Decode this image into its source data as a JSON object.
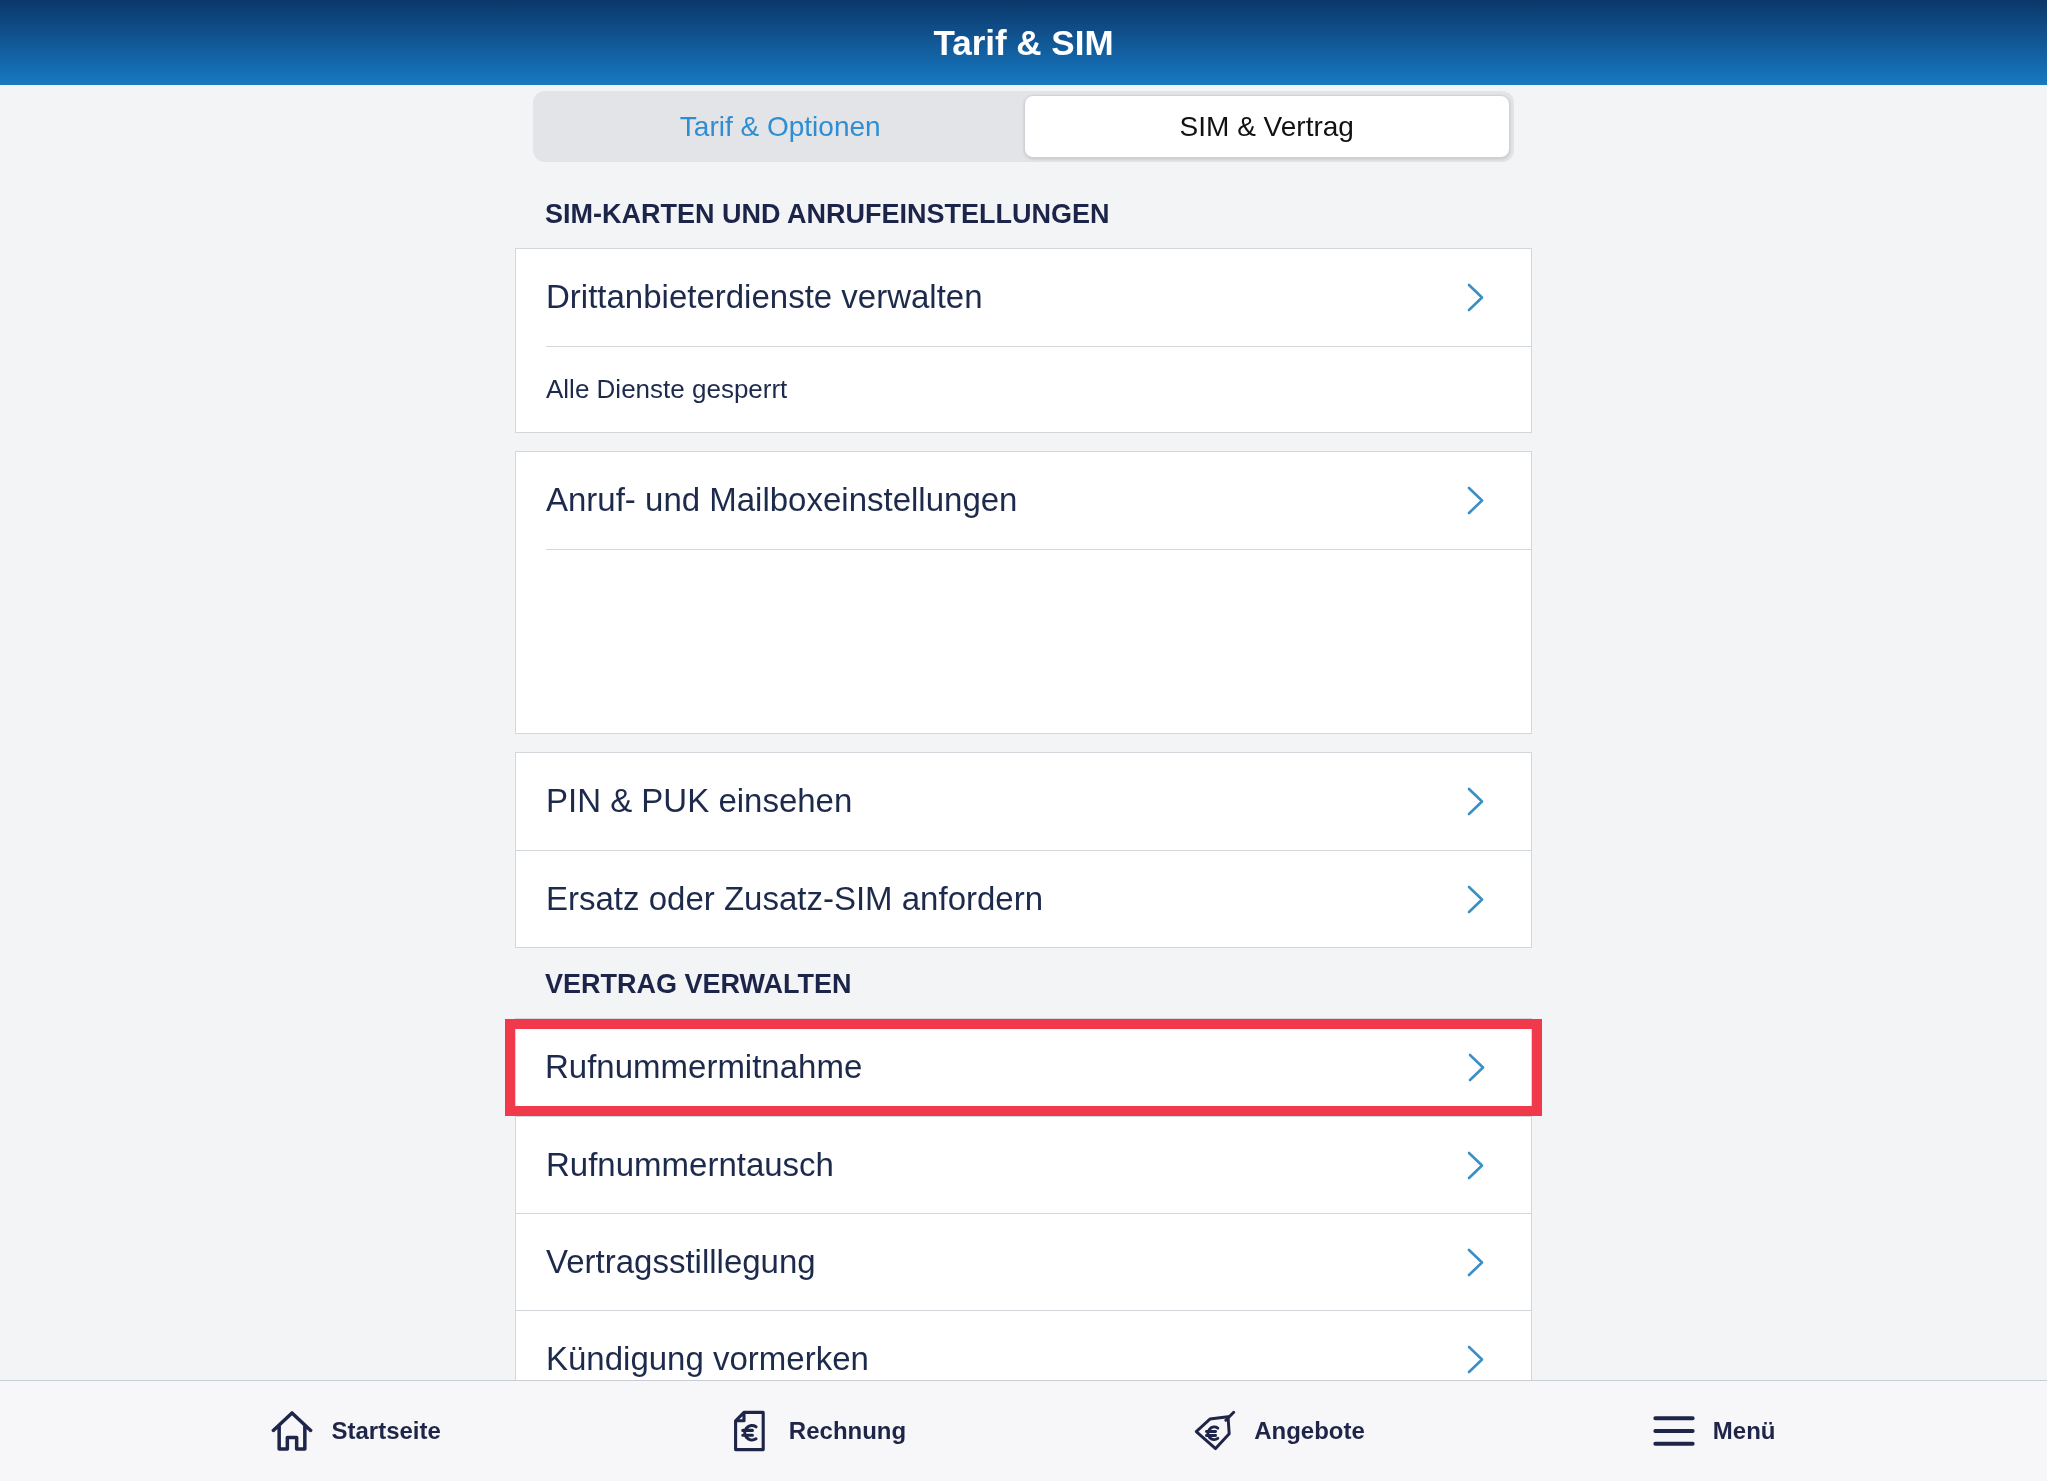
{
  "header": {
    "title": "Tarif & SIM"
  },
  "tabs": [
    {
      "label": "Tarif & Optionen",
      "selected": false
    },
    {
      "label": "SIM & Vertrag",
      "selected": true
    }
  ],
  "sections": [
    {
      "title": "SIM-KARTEN UND ANRUFEINSTELLUNGEN",
      "cards": [
        {
          "rows": [
            {
              "kind": "link",
              "label": "Drittanbieterdienste verwalten",
              "highlighted": false
            },
            {
              "kind": "note",
              "text": "Alle Dienste gesperrt"
            }
          ]
        },
        {
          "rows": [
            {
              "kind": "link",
              "label": "Anruf- und Mailboxeinstellungen",
              "highlighted": false
            },
            {
              "kind": "blank"
            }
          ]
        },
        {
          "rows": [
            {
              "kind": "link",
              "label": "PIN & PUK einsehen",
              "highlighted": false
            },
            {
              "kind": "link",
              "label": "Ersatz oder Zusatz-SIM anfordern",
              "highlighted": false
            }
          ]
        }
      ]
    },
    {
      "title": "VERTRAG VERWALTEN",
      "cards": [
        {
          "rows": [
            {
              "kind": "link",
              "label": "Rufnummermitnahme",
              "highlighted": true
            },
            {
              "kind": "link",
              "label": "Rufnummerntausch",
              "highlighted": false
            },
            {
              "kind": "link",
              "label": "Vertragsstilllegung",
              "highlighted": false
            },
            {
              "kind": "link",
              "label": "Kündigung vormerken",
              "highlighted": false
            }
          ]
        }
      ]
    }
  ],
  "nav": [
    {
      "label": "Startseite"
    },
    {
      "label": "Rechnung"
    },
    {
      "label": "Angebote"
    },
    {
      "label": "Menü"
    }
  ]
}
